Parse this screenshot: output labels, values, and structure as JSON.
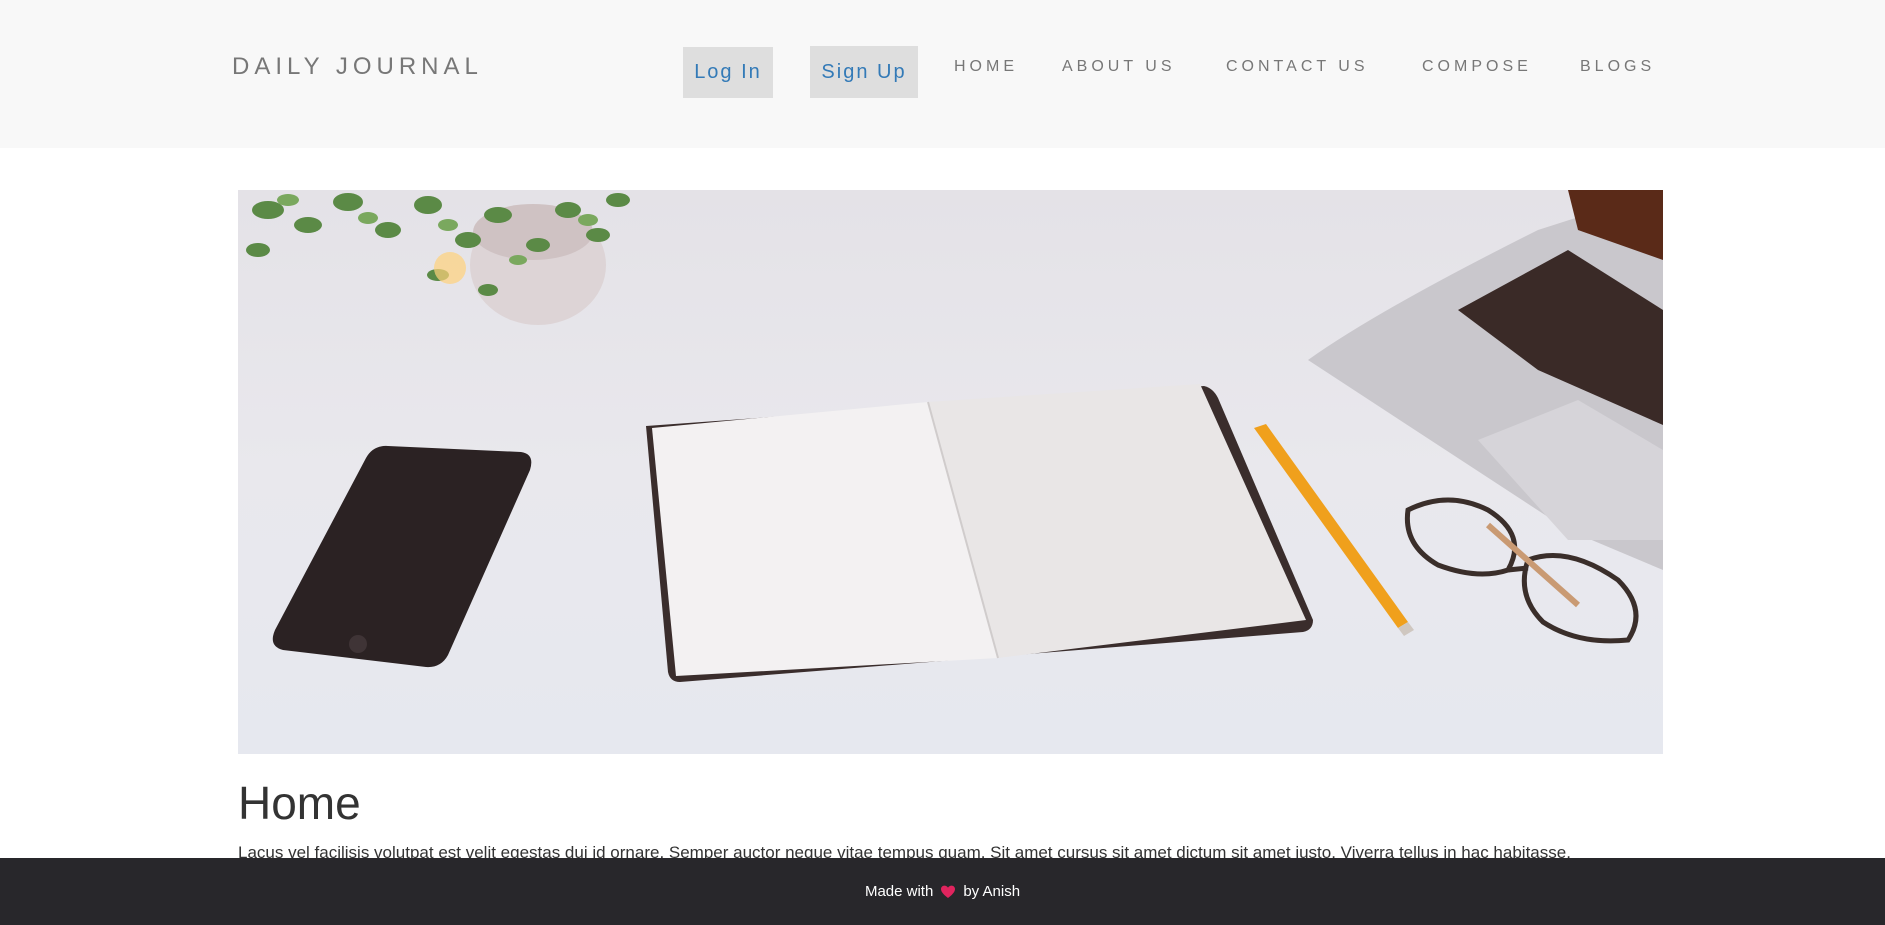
{
  "header": {
    "brand": "DAILY JOURNAL",
    "login_label": "Log In",
    "signup_label": "Sign Up",
    "nav": {
      "home": "HOME",
      "about": "ABOUT US",
      "contact": "CONTACT US",
      "compose": "COMPOSE",
      "blogs": "BLOGS"
    }
  },
  "main": {
    "hero_image": "desk-photo",
    "title": "Home",
    "body": "Lacus vel facilisis volutpat est velit egestas dui id ornare. Semper auctor neque vitae tempus quam. Sit amet cursus sit amet dictum sit amet justo. Viverra tellus in hac habitasse."
  },
  "footer": {
    "made_with": "Made with",
    "by": "by Anish",
    "heart_icon": "heart-icon"
  },
  "colors": {
    "navbar_bg": "#f8f8f8",
    "link_blue": "#337ab7",
    "footer_bg": "#28272b",
    "heart": "#e0245e"
  }
}
